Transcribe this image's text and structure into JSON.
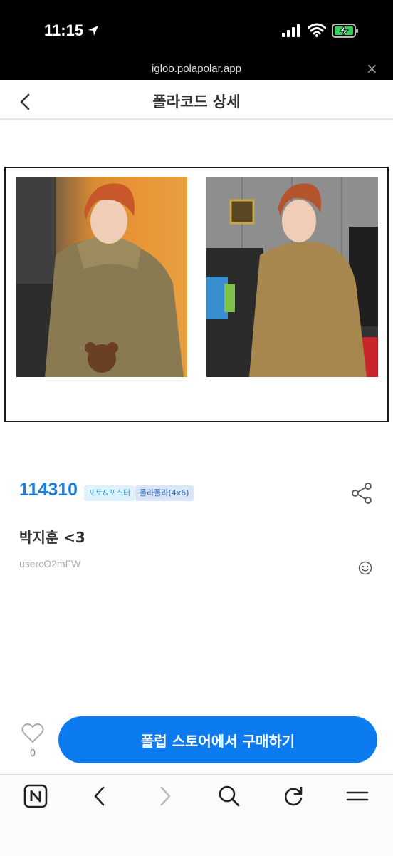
{
  "status_bar": {
    "time": "11:15"
  },
  "browser": {
    "url": "igloo.polapolar.app",
    "close_glyph": "×"
  },
  "header": {
    "title": "폴라코드 상세"
  },
  "item": {
    "code": "114310",
    "tags": [
      "포토&포스터",
      "폴라폴라(4x6)"
    ],
    "title": "박지훈 <3",
    "username": "usercO2mFW"
  },
  "actions": {
    "like_count": "0",
    "buy_label": "폴럽 스토어에서 구매하기"
  },
  "icons": [
    "location-arrow-icon",
    "signal-icon",
    "wifi-icon",
    "battery-charging-icon",
    "back-chevron-icon",
    "share-icon",
    "smiley-icon",
    "heart-icon",
    "naver-home-icon",
    "browser-back-icon",
    "browser-forward-icon",
    "search-icon",
    "refresh-icon",
    "menu-icon"
  ],
  "colors": {
    "accent": "#0d7bf0",
    "code_blue": "#1a7fe0",
    "badge1_bg": "#dff1fb",
    "badge2_bg": "#d9e6f7"
  }
}
